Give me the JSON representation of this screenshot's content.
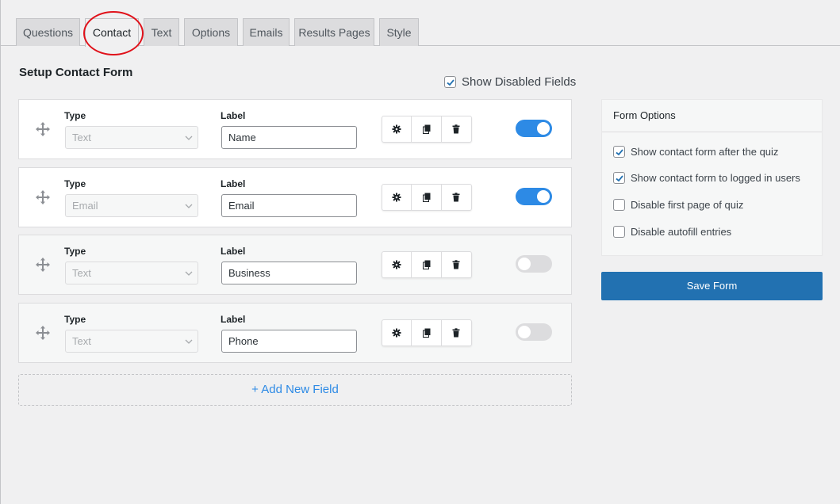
{
  "tabs": [
    {
      "label": "Questions",
      "active": false
    },
    {
      "label": "Contact",
      "active": true
    },
    {
      "label": "Text",
      "active": false
    },
    {
      "label": "Options",
      "active": false
    },
    {
      "label": "Emails",
      "active": false
    },
    {
      "label": "Results Pages",
      "active": false
    },
    {
      "label": "Style",
      "active": false
    }
  ],
  "section_title": "Setup Contact Form",
  "show_disabled": {
    "label": "Show Disabled Fields",
    "checked": true
  },
  "field_headers": {
    "type": "Type",
    "label": "Label"
  },
  "fields": [
    {
      "type": "Text",
      "label": "Name",
      "enabled": true
    },
    {
      "type": "Email",
      "label": "Email",
      "enabled": true
    },
    {
      "type": "Text",
      "label": "Business",
      "enabled": false
    },
    {
      "type": "Text",
      "label": "Phone",
      "enabled": false
    }
  ],
  "add_field_label": "+ Add New Field",
  "form_options": {
    "title": "Form Options",
    "items": [
      {
        "label": "Show contact form after the quiz",
        "checked": true
      },
      {
        "label": "Show contact form to logged in users",
        "checked": true
      },
      {
        "label": "Disable first page of quiz",
        "checked": false
      },
      {
        "label": "Disable autofill entries",
        "checked": false
      }
    ]
  },
  "save_label": "Save Form",
  "colors": {
    "accent": "#2271b1",
    "toggle_on": "#2d8ae5",
    "annotation": "#e0111a"
  },
  "icons": [
    "move-icon",
    "gear-icon",
    "duplicate-icon",
    "trash-icon",
    "chevron-down-icon",
    "check-icon"
  ]
}
